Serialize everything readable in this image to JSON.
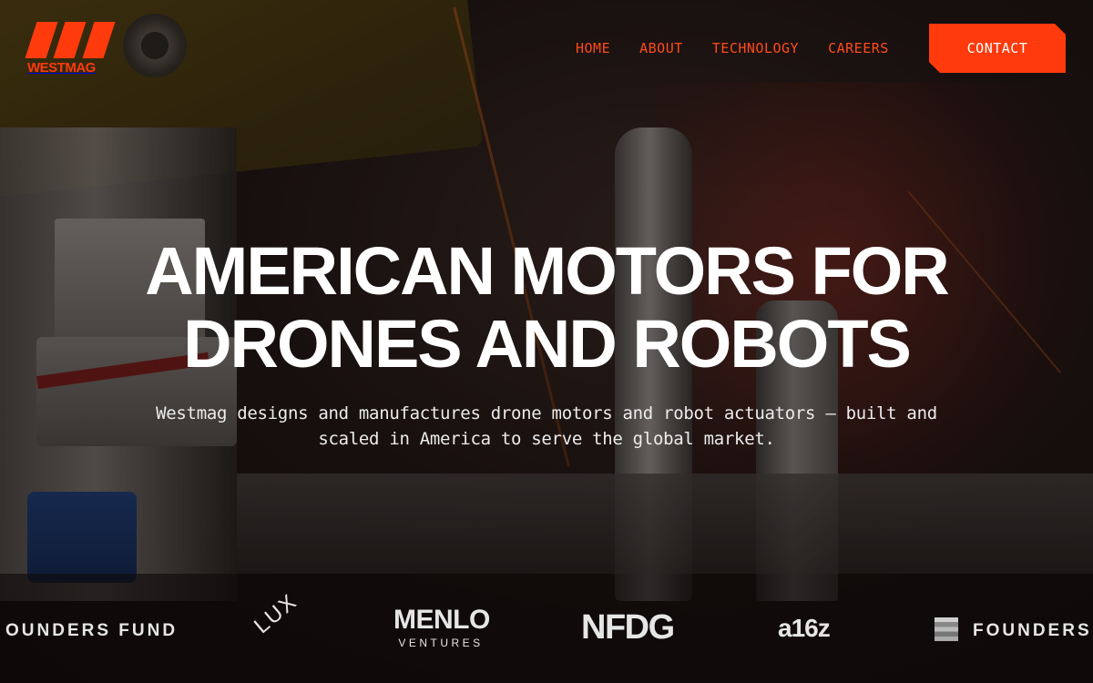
{
  "brand": {
    "name": "WESTMAG",
    "logo_icon": "westmag-stripes-icon",
    "accent": "#ff3a0c"
  },
  "nav": {
    "items": [
      {
        "label": "HOME"
      },
      {
        "label": "ABOUT"
      },
      {
        "label": "TECHNOLOGY"
      },
      {
        "label": "CAREERS"
      }
    ],
    "cta_label": "CONTACT"
  },
  "hero": {
    "title_line1": "AMERICAN MOTORS FOR",
    "title_line2": "DRONES AND ROBOTS",
    "subtitle": "Westmag designs and manufactures drone motors and robot actuators — built and scaled in America to serve the global market."
  },
  "investors": {
    "founders_fund_partial": "OUNDERS FUND",
    "lux": "LUX",
    "menlo_main": "MENLO",
    "menlo_sub": "VENTURES",
    "nfdg": "NFDG",
    "a16z": "a16z",
    "founders_fund_right": "FOUNDERS"
  }
}
